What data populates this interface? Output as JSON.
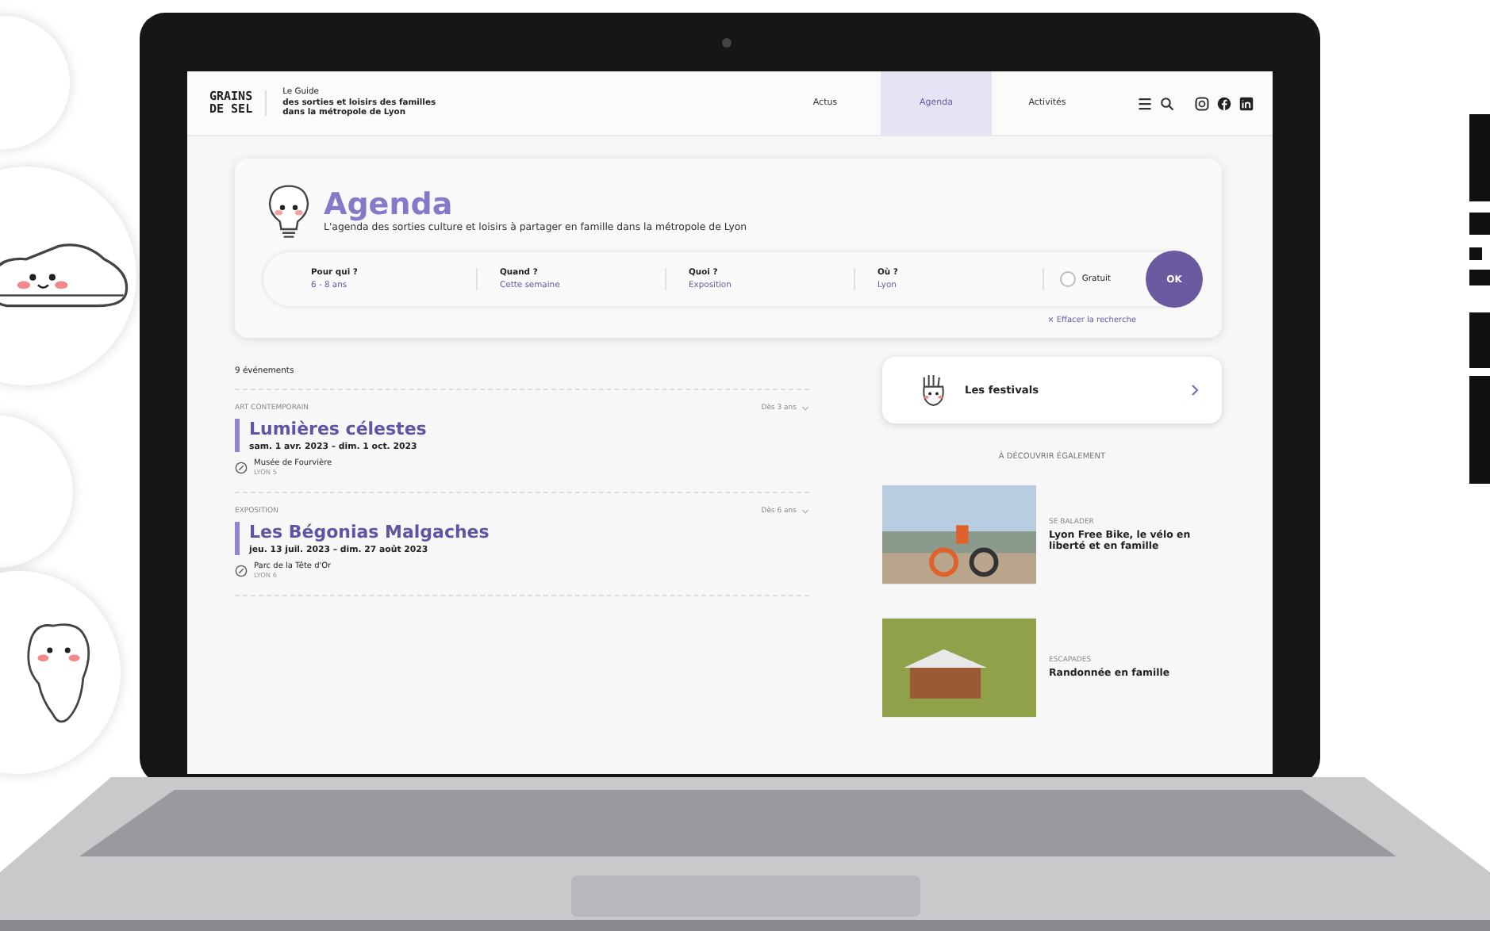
{
  "site": {
    "logo_lines": [
      "GRAINS",
      "DE SEL"
    ],
    "tagline": [
      "Le Guide",
      "des sorties et loisirs des familles",
      "dans la métropole de Lyon"
    ]
  },
  "nav": [
    {
      "label": "Actus",
      "selected": false
    },
    {
      "label": "Agenda",
      "selected": true
    },
    {
      "label": "Activités",
      "selected": false
    }
  ],
  "agenda": {
    "title": "Agenda",
    "subtitle": "L'agenda des sorties culture et loisirs à partager en famille dans la métropole de Lyon",
    "filters": [
      {
        "label": "Pour qui ?",
        "value": "6 - 8 ans"
      },
      {
        "label": "Quand ?",
        "value": "Cette semaine"
      },
      {
        "label": "Quoi ?",
        "value": "Exposition"
      },
      {
        "label": "Où ?",
        "value": "Lyon"
      }
    ],
    "free": {
      "label": "Gratuit",
      "checked": false
    },
    "submit": "OK",
    "clear": "× Effacer la recherche"
  },
  "results": {
    "count": "9 événements",
    "events": [
      {
        "category": "ART CONTEMPORAIN",
        "age": "Dès 3 ans",
        "title": "Lumières célestes",
        "dates": "sam. 1 avr. 2023  –  dim. 1 oct. 2023",
        "venue": "Musée de Fourvière",
        "district": "LYON 5"
      },
      {
        "category": "EXPOSITION",
        "age": "Dès 6 ans",
        "title": "Les Bégonias Malgaches",
        "dates": "jeu. 13 juil. 2023  –  dim. 27 août 2023",
        "venue": "Parc de la Tête d'Or",
        "district": "LYON 6"
      }
    ]
  },
  "sidebar": {
    "festivals": "Les festivals",
    "discover": "À DÉCOUVRIR ÉGALEMENT",
    "articles": [
      {
        "kind": "bike",
        "category": "SE BALADER",
        "title": "Lyon Free Bike, le vélo en liberté et en famille"
      },
      {
        "kind": "hike",
        "category": "ESCAPADES",
        "title": "Randonnée en famille"
      }
    ]
  }
}
